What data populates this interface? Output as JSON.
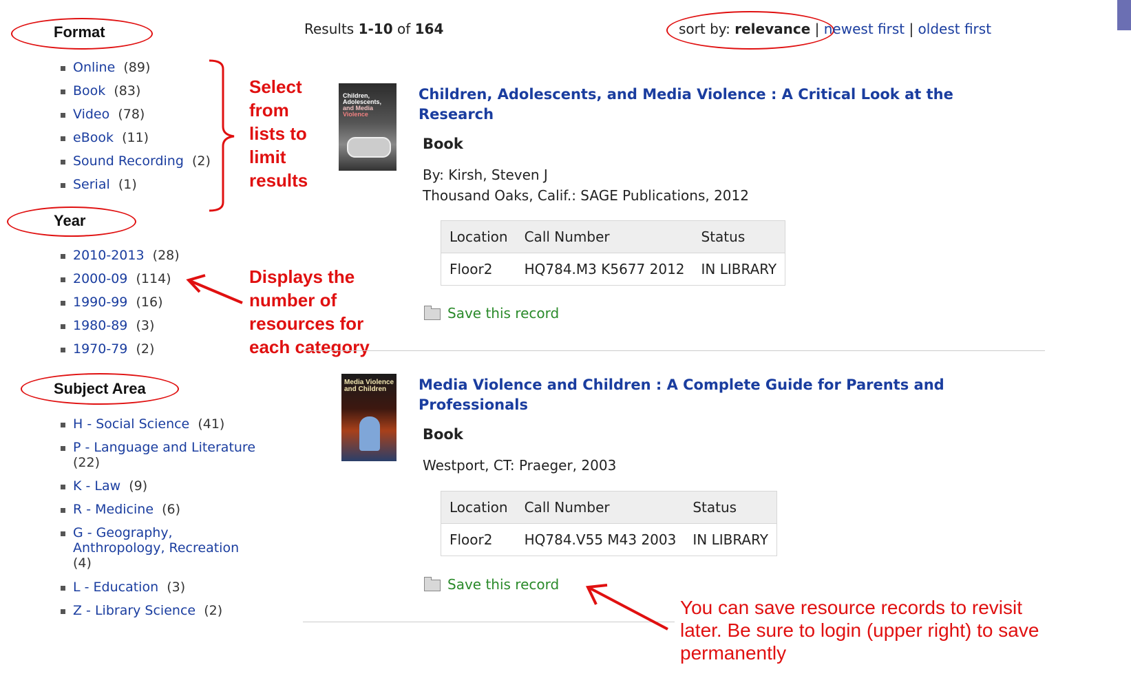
{
  "facets": [
    {
      "heading": "Format",
      "items": [
        {
          "label": "Online",
          "count": "(89)"
        },
        {
          "label": "Book",
          "count": "(83)"
        },
        {
          "label": "Video",
          "count": "(78)"
        },
        {
          "label": "eBook",
          "count": "(11)"
        },
        {
          "label": "Sound Recording",
          "count": "(2)"
        },
        {
          "label": "Serial",
          "count": "(1)"
        }
      ]
    },
    {
      "heading": "Year",
      "items": [
        {
          "label": "2010-2013",
          "count": "(28)"
        },
        {
          "label": "2000-09",
          "count": "(114)"
        },
        {
          "label": "1990-99",
          "count": "(16)"
        },
        {
          "label": "1980-89",
          "count": "(3)"
        },
        {
          "label": "1970-79",
          "count": "(2)"
        }
      ]
    },
    {
      "heading": "Subject Area",
      "items": [
        {
          "label": "H - Social Science",
          "count": "(41)"
        },
        {
          "label": "P - Language and Literature",
          "count": "(22)"
        },
        {
          "label": "K - Law",
          "count": "(9)"
        },
        {
          "label": "R - Medicine",
          "count": "(6)"
        },
        {
          "label": "G - Geography, Anthropology, Recreation",
          "count": "(4)"
        },
        {
          "label": "L - Education",
          "count": "(3)"
        },
        {
          "label": "Z - Library Science",
          "count": "(2)"
        }
      ]
    }
  ],
  "annotations": {
    "select": [
      "Select",
      "from",
      "lists to",
      "limit",
      "results"
    ],
    "displays": [
      "Displays the",
      "number of",
      "resources for",
      "each category"
    ],
    "save_note": [
      "You can save resource records to revisit",
      "later.  Be sure to login (upper right) to save",
      "permanently"
    ]
  },
  "results_header": {
    "prefix": "Results ",
    "range": "1-10",
    "of": " of ",
    "total": "164"
  },
  "sort": {
    "label": "sort by: ",
    "current": "relevance",
    "sep": " | ",
    "newest": "newest first",
    "oldest": "oldest first"
  },
  "records": [
    {
      "title_line1": "Children, Adolescents, and Media Violence : A Critical Look at the",
      "title_line2": "Research",
      "format": "Book",
      "author": "By: Kirsh, Steven J",
      "publisher": "Thousand Oaks, Calif.: SAGE Publications, 2012",
      "holdings_headers": [
        "Location",
        "Call Number",
        "Status"
      ],
      "holdings": [
        "Floor2",
        "HQ784.M3 K5677 2012",
        "IN LIBRARY"
      ],
      "save": "Save this record",
      "cover_text": [
        "Children,",
        "Adolescents,",
        "and Media",
        "Violence"
      ]
    },
    {
      "title_line1": "Media Violence and Children : A Complete Guide for Parents and",
      "title_line2": "Professionals",
      "format": "Book",
      "publisher": "Westport, CT: Praeger, 2003",
      "holdings_headers": [
        "Location",
        "Call Number",
        "Status"
      ],
      "holdings": [
        "Floor2",
        "HQ784.V55 M43 2003",
        "IN LIBRARY"
      ],
      "save": "Save this record",
      "cover_text": [
        "Media Violence",
        "and Children"
      ]
    }
  ],
  "colors": {
    "accent_red": "#e01010",
    "link_blue": "#1a3d9f",
    "save_green": "#2a8a2a"
  }
}
